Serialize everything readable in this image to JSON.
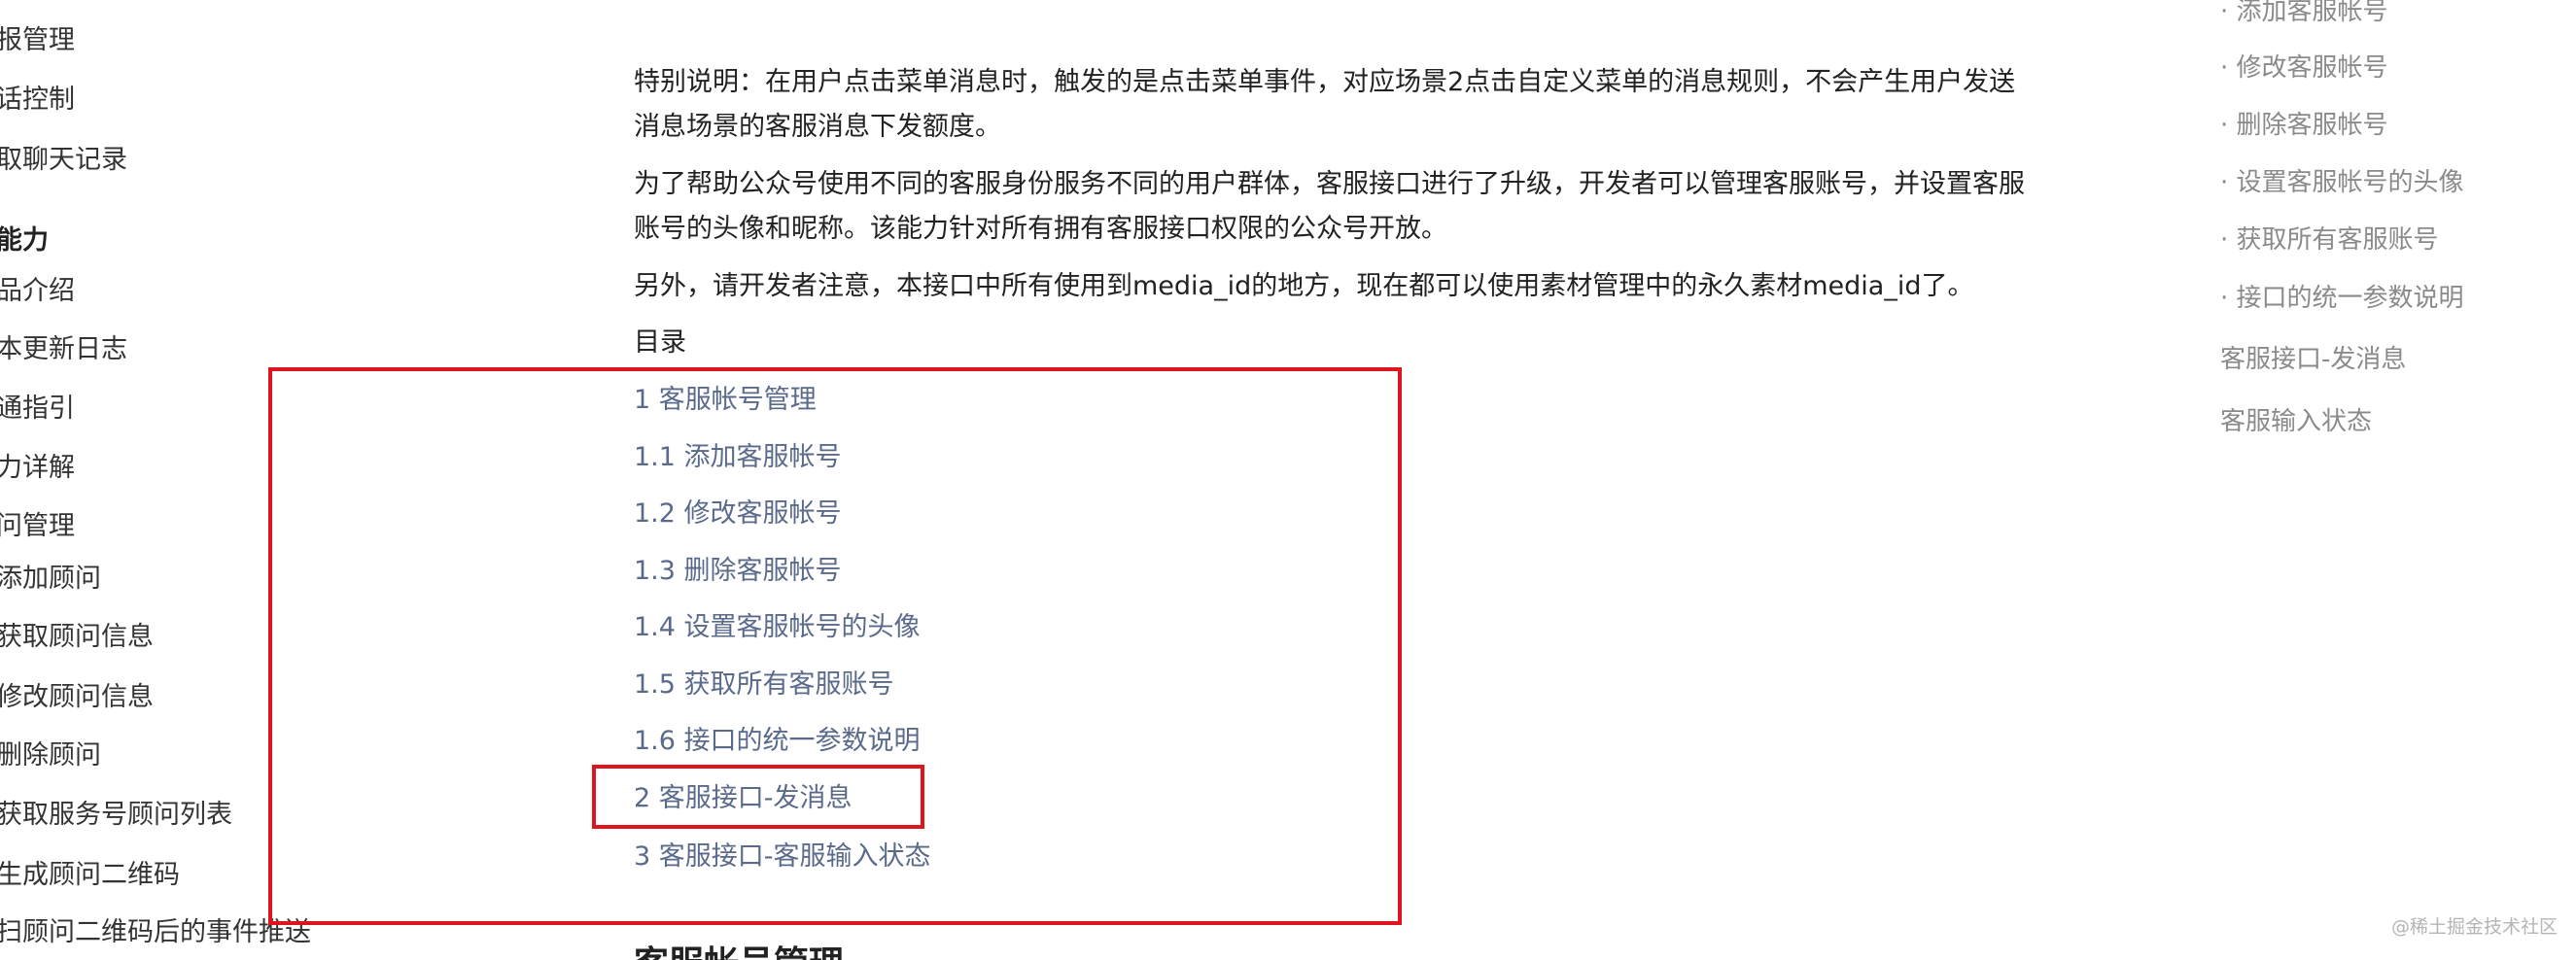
{
  "left_nav": {
    "items": [
      {
        "label": "报管理",
        "heading": false
      },
      {
        "label": "话控制",
        "heading": false
      },
      {
        "label": "取聊天记录",
        "heading": false
      },
      {
        "label": "能力",
        "heading": true
      },
      {
        "label": "品介绍",
        "heading": false
      },
      {
        "label": "本更新日志",
        "heading": false
      },
      {
        "label": "通指引",
        "heading": false
      },
      {
        "label": "力详解",
        "heading": false
      },
      {
        "label": "问管理",
        "heading": false
      },
      {
        "label": "添加顾问",
        "heading": false
      },
      {
        "label": "获取顾问信息",
        "heading": false
      },
      {
        "label": "修改顾问信息",
        "heading": false
      },
      {
        "label": "删除顾问",
        "heading": false
      },
      {
        "label": "获取服务号顾问列表",
        "heading": false
      },
      {
        "label": "生成顾问二维码",
        "heading": false
      },
      {
        "label": "扫顾问二维码后的事件推送",
        "heading": false
      }
    ]
  },
  "content": {
    "para1": "特别说明：在用户点击菜单消息时，触发的是点击菜单事件，对应场景2点击自定义菜单的消息规则，不会产生用户发送消息场景的客服消息下发额度。",
    "para2": "为了帮助公众号使用不同的客服身份服务不同的用户群体，客服接口进行了升级，开发者可以管理客服账号，并设置客服账号的头像和昵称。该能力针对所有拥有客服接口权限的公众号开放。",
    "para3": "另外，请开发者注意，本接口中所有使用到media_id的地方，现在都可以使用素材管理中的永久素材media_id了。",
    "toc_title": "目录",
    "toc": [
      "1 客服帐号管理",
      "1.1 添加客服帐号",
      "1.2 修改客服帐号",
      "1.3 删除客服帐号",
      "1.4 设置客服帐号的头像",
      "1.5 获取所有客服账号",
      "1.6 接口的统一参数说明",
      "2 客服接口-发消息",
      "3 客服接口-客服输入状态"
    ],
    "next_heading": "客服帐号管理"
  },
  "right_outline": {
    "items": [
      "· 添加客服帐号",
      "· 修改客服帐号",
      "· 删除客服帐号",
      "· 设置客服帐号的头像",
      "· 获取所有客服账号",
      "· 接口的统一参数说明",
      "客服接口-发消息",
      "客服输入状态"
    ]
  },
  "watermark": "@稀土掘金技术社区",
  "colors": {
    "annotation": "#e0141e",
    "toc_link": "#5a6a8a",
    "outline_text": "#8a8a8a"
  }
}
